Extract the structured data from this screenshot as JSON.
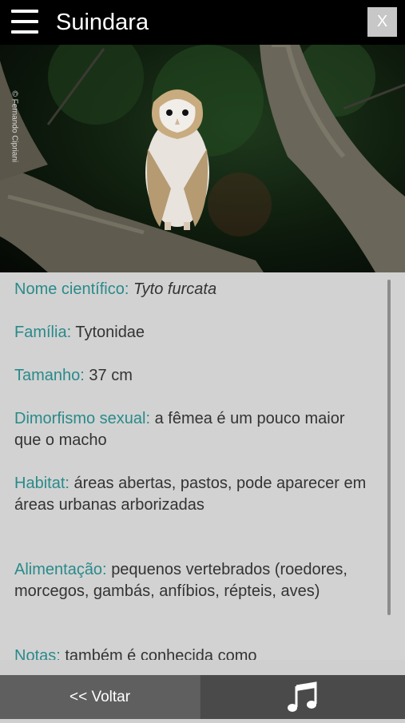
{
  "header": {
    "title": "Suindara",
    "close_label": "X"
  },
  "photo": {
    "credit": "© Fernando Cipriani"
  },
  "species": {
    "nome_label": "Nome científico:",
    "nome_value": "Tyto furcata",
    "familia_label": "Família:",
    "familia_value": "Tytonidae",
    "tamanho_label": "Tamanho:",
    "tamanho_value": "37 cm",
    "dimorfismo_label": "Dimorfismo sexual:",
    "dimorfismo_value": "a fêmea é um pouco maior que o macho",
    "habitat_label": "Habitat:",
    "habitat_value": "áreas abertas, pastos, pode aparecer em áreas urbanas arborizadas",
    "alimentacao_label": "Alimentação:",
    "alimentacao_value": "pequenos vertebrados (roedores, morcegos, gambás, anfíbios, répteis, aves)",
    "notas_label": "Notas:",
    "notas_value": "também é conhecida como"
  },
  "footer": {
    "back_label": "<< Voltar",
    "audio_icon": "music-note-icon"
  }
}
